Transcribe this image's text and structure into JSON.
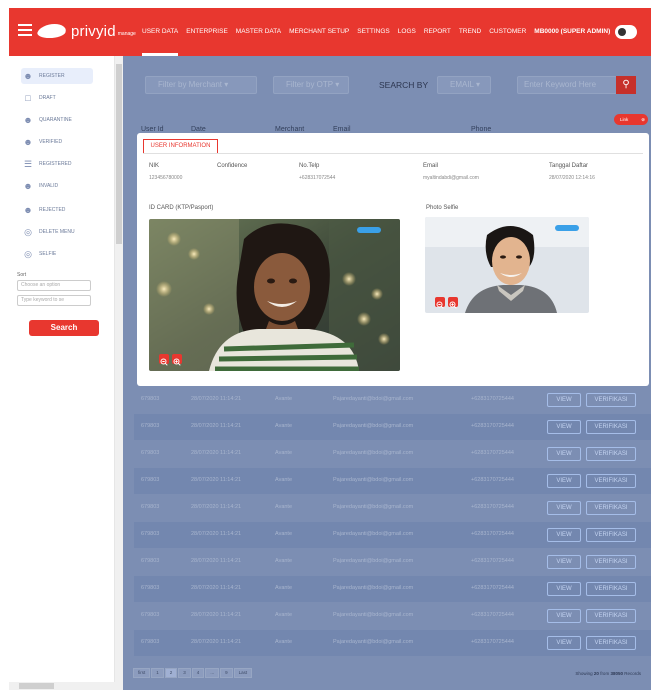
{
  "header": {
    "logo_text": "privyid",
    "logo_sub": "manage",
    "nav": [
      "USER DATA",
      "ENTERPRISE",
      "MASTER DATA",
      "MERCHANT SETUP",
      "SETTINGS",
      "LOGS",
      "REPORT",
      "TREND",
      "CUSTOMER",
      "MB0000 (SUPER ADMIN)"
    ],
    "active_nav": "USER DATA"
  },
  "sidebar": {
    "items": [
      {
        "label": "REGISTER",
        "icon": "user-icon"
      },
      {
        "label": "DRAFT",
        "icon": "document-icon"
      },
      {
        "label": "QUARANTINE",
        "icon": "user-icon"
      },
      {
        "label": "VERIFIED",
        "icon": "user-icon"
      },
      {
        "label": "REGISTERED",
        "icon": "list-icon"
      },
      {
        "label": "INVALID",
        "icon": "user-icon"
      },
      {
        "label": "REJECTED",
        "icon": "user-icon"
      },
      {
        "label": "DELETE MENU",
        "icon": "fingerprint-icon"
      },
      {
        "label": "SELFIE",
        "icon": "fingerprint-icon"
      }
    ],
    "sort_label": "Sort",
    "sort_placeholder": "Choose an option",
    "keyword_placeholder": "Type keyword to se",
    "search_label": "Search"
  },
  "filters": {
    "merchant": "Filter by Merchant",
    "otp": "Filter by OTP",
    "search_by_label": "SEARCH BY",
    "search_by_value": "EMAIL",
    "keyword_placeholder": "Enter Keyword Here",
    "link_label": "Link"
  },
  "table": {
    "headers": [
      "User Id",
      "Date",
      "Merchant",
      "Email",
      "Phone"
    ],
    "rows": [
      {
        "id": "679803",
        "date": "28/07/2020 11:14:21",
        "merchant": "Avante",
        "email": "Pajaredayanti@bdoi@gmail.com",
        "phone": "+6283170725444"
      },
      {
        "id": "679803",
        "date": "28/07/2020 11:14:21",
        "merchant": "Avante",
        "email": "Pajaredayanti@bdoi@gmail.com",
        "phone": "+6283170725444"
      },
      {
        "id": "679803",
        "date": "28/07/2020 11:14:21",
        "merchant": "Avante",
        "email": "Pajaredayanti@bdoi@gmail.com",
        "phone": "+6283170725444"
      },
      {
        "id": "679803",
        "date": "28/07/2020 11:14:21",
        "merchant": "Avante",
        "email": "Pajaredayanti@bdoi@gmail.com",
        "phone": "+6283170725444"
      },
      {
        "id": "679803",
        "date": "28/07/2020 11:14:21",
        "merchant": "Avante",
        "email": "Pajaredayanti@bdoi@gmail.com",
        "phone": "+6283170725444"
      },
      {
        "id": "679803",
        "date": "28/07/2020 11:14:21",
        "merchant": "Avante",
        "email": "Pajaredayanti@bdoi@gmail.com",
        "phone": "+6283170725444"
      },
      {
        "id": "679803",
        "date": "28/07/2020 11:14:21",
        "merchant": "Avante",
        "email": "Pajaredayanti@bdoi@gmail.com",
        "phone": "+6283170725444"
      },
      {
        "id": "679803",
        "date": "28/07/2020 11:14:21",
        "merchant": "Avante",
        "email": "Pajaredayanti@bdoi@gmail.com",
        "phone": "+6283170725444"
      },
      {
        "id": "679803",
        "date": "28/07/2020 11:14:21",
        "merchant": "Avante",
        "email": "Pajaredayanti@bdoi@gmail.com",
        "phone": "+6283170725444"
      },
      {
        "id": "679803",
        "date": "28/07/2020 11:14:21",
        "merchant": "Avante",
        "email": "Pajaredayanti@bdoi@gmail.com",
        "phone": "+6283170725444"
      }
    ],
    "view_label": "VIEW",
    "verify_label": "VERIFIKASI"
  },
  "pagination": {
    "items": [
      "first",
      "1",
      "2",
      "3",
      "4",
      "...",
      "9",
      "Last"
    ],
    "current": "2",
    "showing_prefix": "Showing",
    "showing_count": "20",
    "showing_mid": "from",
    "showing_total": "38050",
    "showing_suffix": "Records"
  },
  "modal": {
    "tab": "USER INFORMATION",
    "fields": [
      {
        "label": "NIK",
        "value": "123456780000"
      },
      {
        "label": "Confidence",
        "value": ""
      },
      {
        "label": "No.Telp",
        "value": "+628317072544"
      },
      {
        "label": "Email",
        "value": "myaltindabdi@gmail.com"
      },
      {
        "label": "Tanggal Daftar",
        "value": "28/07/2020 12:14:16"
      }
    ],
    "id_card_label": "ID CARD (KTP/Pasport)",
    "selfie_label": "Photo Selfie"
  },
  "colors": {
    "brand": "#e8372f",
    "overlay": "#7c8eb3",
    "badge": "#3aa0e8"
  }
}
